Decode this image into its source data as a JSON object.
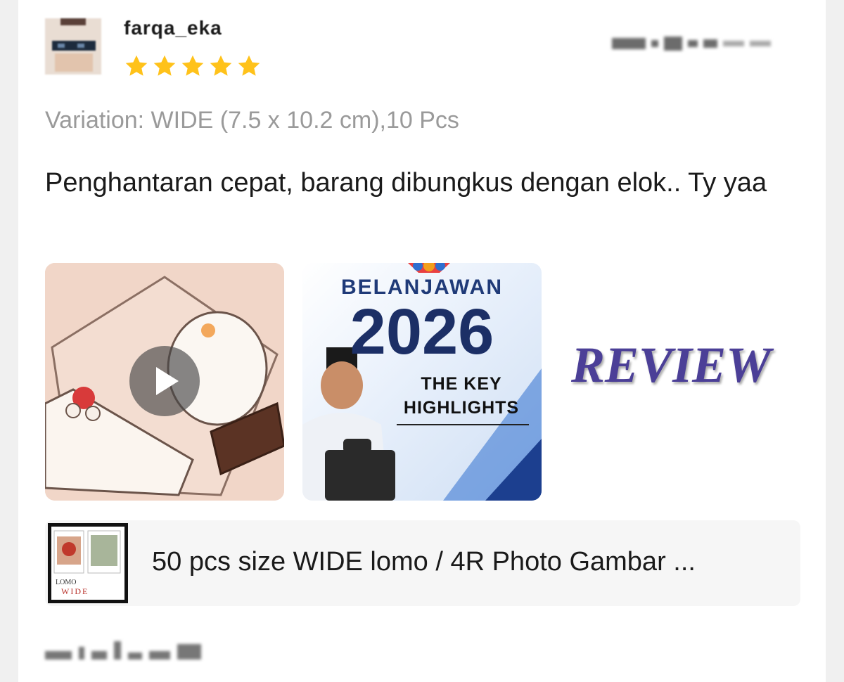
{
  "review": {
    "username": "farqa_eka",
    "rating": 5,
    "rating_max": 5,
    "variation": "Variation: WIDE (7.5 x 10.2 cm),10 Pcs",
    "text": "Penghantaran cepat, barang dibungkus dengan elok.. Ty yaa"
  },
  "media": {
    "photo": {
      "heading": "BELANJAWAN",
      "year": "2026",
      "line1": "THE KEY",
      "line2": "HIGHLIGHTS"
    },
    "review_label": "REVIEW"
  },
  "product": {
    "title": "50 pcs size WIDE lomo / 4R Photo Gambar ...",
    "thumb_top": "LOMO",
    "thumb_bottom": "WIDE"
  },
  "colors": {
    "star": "#ffc21a",
    "review_label": "#4b3f97",
    "variation_text": "#9a9a9a"
  }
}
